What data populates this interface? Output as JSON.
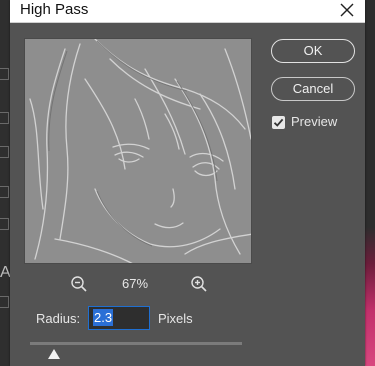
{
  "dialog": {
    "title": "High Pass"
  },
  "preview": {
    "zoom_level": "67%"
  },
  "buttons": {
    "ok_label": "OK",
    "cancel_label": "Cancel"
  },
  "options": {
    "preview_label": "Preview",
    "preview_checked": true
  },
  "radius": {
    "label": "Radius:",
    "value": "2.3",
    "unit": "Pixels"
  },
  "colors": {
    "dialog_bg": "#535353",
    "selection": "#2a6fd6",
    "preview_bg": "#8f8f8f"
  },
  "background_app": {
    "left_letter": "A"
  }
}
